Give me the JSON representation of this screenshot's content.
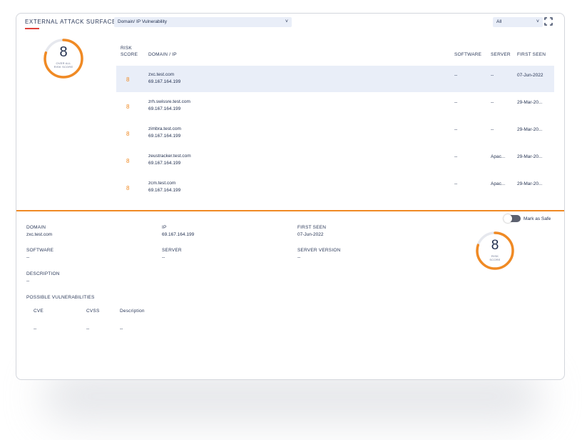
{
  "header": {
    "title": "EXTERNAL ATTACK SURFACE",
    "filter_type": "Domain/ IP Vulnerability",
    "filter_scope": "All"
  },
  "overall_gauge": {
    "score": "8",
    "caption_line1": "OVER ALL",
    "caption_line2": "RISK SCORE",
    "level": 0.8
  },
  "table": {
    "headers": {
      "risk_line1": "RISK",
      "risk_line2": "SCORE",
      "domain": "DOMAIN / IP",
      "software": "SOFTWARE",
      "server": "SERVER",
      "first_seen": "FIRST SEEN"
    },
    "rows": [
      {
        "score": "8",
        "domain": "zxc.test.com",
        "ip": "69.167.164.199",
        "software": "--",
        "server": "--",
        "first_seen": "07-Jun-2022"
      },
      {
        "score": "8",
        "domain": "zrh.swissre.test.com",
        "ip": "69.167.164.199",
        "software": "--",
        "server": "--",
        "first_seen": "29-Mar-20..."
      },
      {
        "score": "8",
        "domain": "zimbra.test.com",
        "ip": "69.167.164.199",
        "software": "--",
        "server": "--",
        "first_seen": "29-Mar-20..."
      },
      {
        "score": "8",
        "domain": "zeustracker.test.com",
        "ip": "69.167.164.199",
        "software": "--",
        "server": "Apac...",
        "first_seen": "29-Mar-20..."
      },
      {
        "score": "8",
        "domain": "zcm.test.com",
        "ip": "69.167.164.199",
        "software": "--",
        "server": "Apac...",
        "first_seen": "29-Mar-20..."
      }
    ]
  },
  "detail": {
    "domain_label": "DOMAIN",
    "domain": "zxc.test.com",
    "ip_label": "IP",
    "ip": "69.167.164.199",
    "first_seen_label": "FIRST SEEN",
    "first_seen": "07-Jun-2022",
    "software_label": "SOFTWARE",
    "software": "--",
    "server_label": "SERVER",
    "server": "--",
    "server_version_label": "SERVER VERSION",
    "server_version": "--",
    "description_label": "DESCRIPTION",
    "description": "--",
    "vuln_label": "POSSIBLE VULNERABILITIES",
    "vuln_headers": {
      "cve": "CVE",
      "cvss": "CVSS",
      "description": "Description"
    },
    "vuln_row": {
      "cve": "--",
      "cvss": "--",
      "description": "--"
    },
    "mark_safe": "Mark as Safe",
    "gauge": {
      "score": "8",
      "caption_line1": "RISK",
      "caption_line2": "SCORE",
      "level": 0.8
    }
  },
  "colors": {
    "accent": "#f08a24",
    "track": "#e6e8ee",
    "selected_row": "#e9eef8",
    "underline": "#e0403a"
  }
}
